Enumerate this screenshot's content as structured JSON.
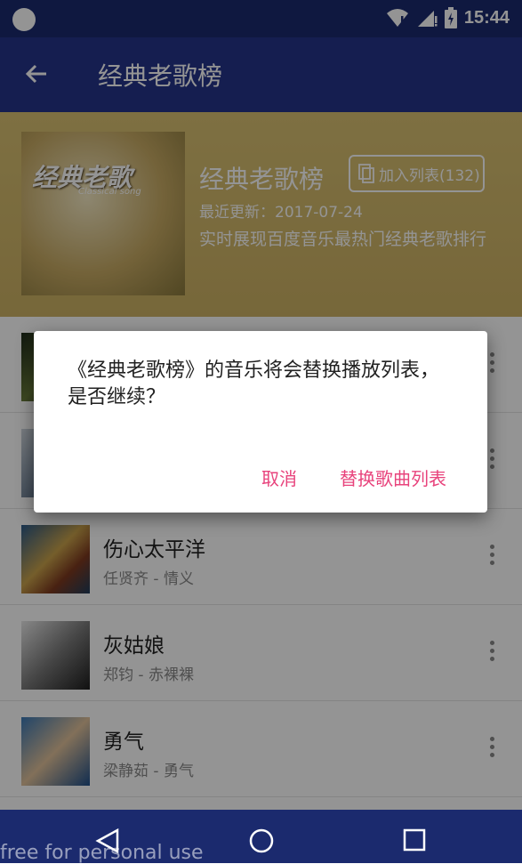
{
  "status_bar": {
    "time": "15:44"
  },
  "toolbar": {
    "back_icon": "arrow-left-icon",
    "title": "经典老歌榜"
  },
  "playlist": {
    "title": "经典老歌榜",
    "add_button_label": "加入列表(132)",
    "updated": "最近更新：2017-07-24",
    "description": "实时展现百度音乐最热门经典老歌排行",
    "cover_text": "经典老歌",
    "cover_subtext": "Classical song"
  },
  "songs": [
    {
      "title": "",
      "artist": ""
    },
    {
      "title": "",
      "artist": ""
    },
    {
      "title": "伤心太平洋",
      "artist": "任贤齐 - 情义"
    },
    {
      "title": "灰姑娘",
      "artist": "郑钧 - 赤裸裸"
    },
    {
      "title": "勇气",
      "artist": "梁静茹 - 勇气"
    }
  ],
  "dialog": {
    "message": "《经典老歌榜》的音乐将会替换播放列表，\n是否继续？",
    "cancel_label": "取消",
    "confirm_label": "替换歌曲列表"
  },
  "watermark": "free for personal use",
  "colors": {
    "accent": "#e8437c",
    "primary": "#25358a",
    "primary_dark": "#1b2a6e"
  }
}
